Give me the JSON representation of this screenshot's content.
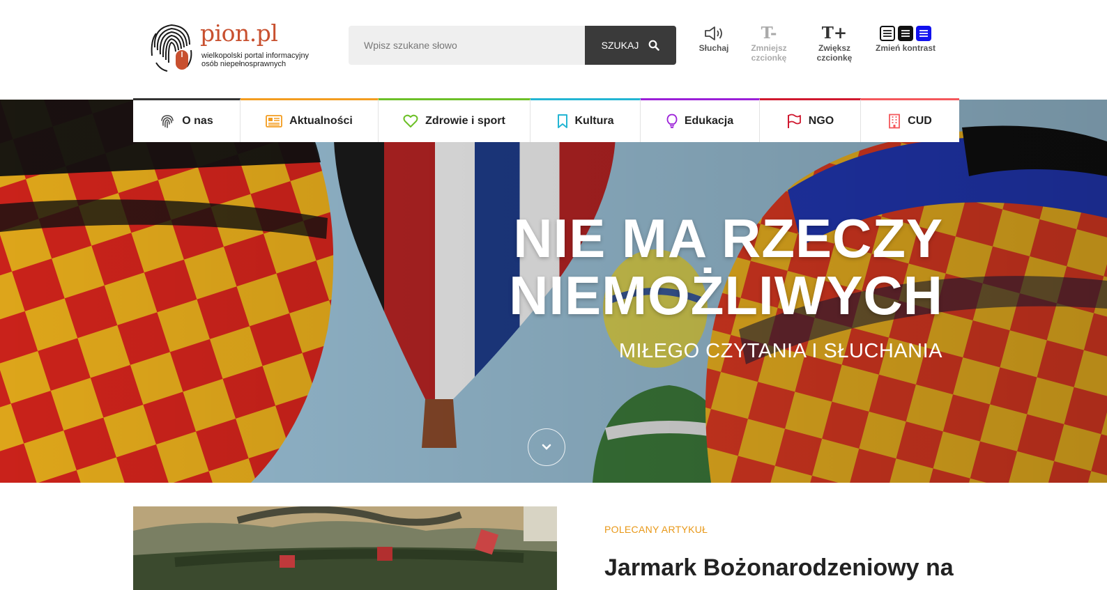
{
  "header": {
    "logo_name": "pion.pl",
    "logo_tagline_1": "wielkopolski portal informacyjny",
    "logo_tagline_2": "osób niepełnosprawnych",
    "search_placeholder": "Wpisz szukane słowo",
    "search_button": "SZUKAJ",
    "tools": {
      "listen": "Słuchaj",
      "smaller_icon": "T-",
      "smaller_1": "Zmniejsz",
      "smaller_2": "czcionkę",
      "bigger_icon": "T+",
      "bigger_1": "Zwiększ",
      "bigger_2": "czcionkę",
      "contrast": "Zmień kontrast"
    }
  },
  "nav": [
    {
      "label": "O nas",
      "icon": "fingerprint-icon",
      "color": "#333333"
    },
    {
      "label": "Aktualności",
      "icon": "newspaper-icon",
      "color": "#f39c1f"
    },
    {
      "label": "Zdrowie i sport",
      "icon": "heart-icon",
      "color": "#6cc027"
    },
    {
      "label": "Kultura",
      "icon": "bookmark-icon",
      "color": "#23b5d3"
    },
    {
      "label": "Edukacja",
      "icon": "lightbulb-icon",
      "color": "#9b1fd8"
    },
    {
      "label": "NGO",
      "icon": "flag-icon",
      "color": "#d0182f"
    },
    {
      "label": "CUD",
      "icon": "building-icon",
      "color": "#f4575b"
    }
  ],
  "hero": {
    "title_line_1": "NIE MA RZECZY",
    "title_line_2": "NIEMOŻLIWYCH",
    "subtitle": "MIŁEGO CZYTANIA I SŁUCHANIA"
  },
  "featured": {
    "label": "POLECANY ARTYKUŁ",
    "title": "Jarmark Bożonarodzeniowy na"
  }
}
